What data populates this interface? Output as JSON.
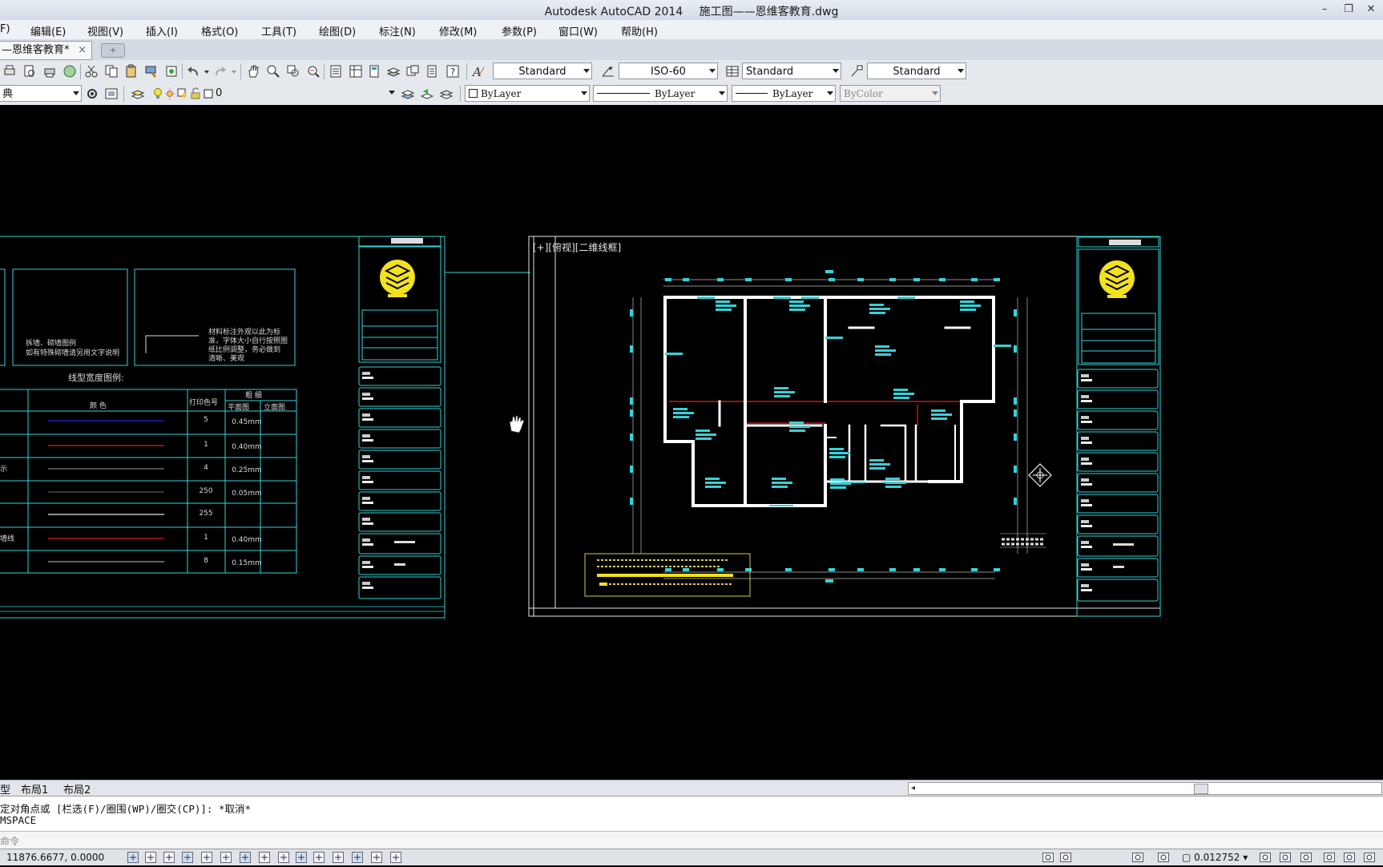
{
  "window": {
    "left_title": "Autodesk AutoCAD 2014",
    "doc_title": "施工图——恩维客教育.dwg"
  },
  "menu": [
    "F)",
    "编辑(E)",
    "视图(V)",
    "插入(I)",
    "格式(O)",
    "工具(T)",
    "绘图(D)",
    "标注(N)",
    "修改(M)",
    "参数(P)",
    "窗口(W)",
    "帮助(H)"
  ],
  "file_tab": {
    "label": "—恩维客教育*",
    "close": "×"
  },
  "toolbar1": {
    "text_style": "Standard",
    "dim_style": "ISO-60",
    "table_style": "Standard",
    "multileader_style": "Standard"
  },
  "toolbar2": {
    "workspace": "典",
    "layer": "0",
    "color": "ByLayer",
    "linetype": "ByLayer",
    "lineweight": "ByLayer",
    "plotstyle": "ByColor"
  },
  "viewport": {
    "label": "[+][俯视][二维线框]"
  },
  "legend": {
    "note_left_1": "拆墙、砌墙图例",
    "note_left_2": "如有特殊砌墙请另用文字说明",
    "note_right_1": "材料标注外观以此为标",
    "note_right_2": "准，字体大小自行按照图",
    "note_right_3": "纸比例调整，务必做到",
    "note_right_4": "清晰、美观",
    "title": "线型宽度图例:",
    "headers": {
      "color": "颜  色",
      "print": "打印色号",
      "thick": "粗    细",
      "plan": "平面图",
      "elev": "立面图"
    },
    "rows": [
      {
        "label": "",
        "print": "5",
        "width": "0.45mm",
        "color": "#2323d8"
      },
      {
        "label": "",
        "print": "1",
        "width": "0.40mm",
        "color": "#e02020"
      },
      {
        "label": "示",
        "print": "4",
        "width": "0.25mm",
        "color": "#7a7a7a"
      },
      {
        "label": "",
        "print": "250",
        "width": "0.05mm",
        "color": "#555555"
      },
      {
        "label": "",
        "print": "255",
        "width": "",
        "color": "#e8e8e8"
      },
      {
        "label": "墙线",
        "print": "1",
        "width": "0.40mm",
        "color": "#e02020"
      },
      {
        "label": "",
        "print": "8",
        "width": "0.15mm",
        "color": "#9a9a9a"
      }
    ]
  },
  "layout_tabs": [
    "型",
    "布局1",
    "布局2"
  ],
  "command": {
    "line1": "定对角点或 [栏选(F)/圈围(WP)/圈交(CP)]: *取消*",
    "line2": "MSPACE",
    "prompt": "命令"
  },
  "status": {
    "coords": "11876.6677, 0.0000",
    "annotation_scale": "0.012752"
  },
  "colors": {
    "accent_cyan": "#35d3d8",
    "logo_yellow": "#f2e21e",
    "wall_white": "#ffffff",
    "axis_red": "#c21818"
  }
}
